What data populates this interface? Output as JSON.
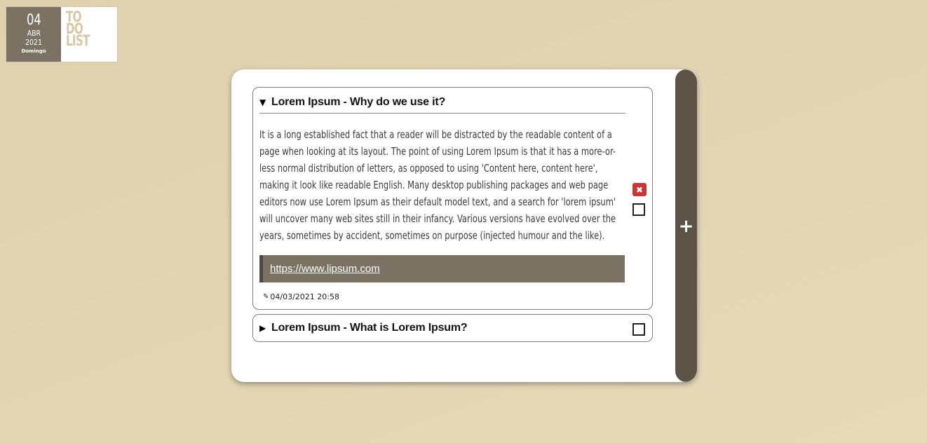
{
  "date_badge": {
    "day": "04",
    "month": "ABR",
    "year": "2021",
    "weekday": "Domingo"
  },
  "logo": {
    "lines": [
      "TO",
      "DO",
      "LIST"
    ]
  },
  "card": {
    "add_label": "+",
    "tasks": [
      {
        "expanded": true,
        "caret": "▼",
        "title": "Lorem Ipsum - Why do we use it?",
        "body": "It is a long established fact that a reader will be distracted by the readable content of a page when looking at its layout. The point of using Lorem Ipsum is that it has a more-or-less normal distribution of letters, as opposed to using 'Content here, content here', making it look like readable English. Many desktop publishing packages and web page editors now use Lorem Ipsum as their default model text, and a search for 'lorem ipsum' will uncover many web sites still in their infancy. Various versions have evolved over the years, sometimes by accident, sometimes on purpose (injected humour and the like).",
        "link": "https://www.lipsum.com",
        "timestamp": "04/03/2021 20:58",
        "delete_label": "✖",
        "checked": false
      },
      {
        "expanded": false,
        "caret": "▶",
        "title": "Lorem Ipsum - What is Lorem Ipsum?",
        "checked": false
      }
    ]
  },
  "colors": {
    "background": "#e0d3af",
    "date_block": "#7b7263",
    "logo_text": "#d8c8a2",
    "sidebar": "#5a5346",
    "link_box": "#7b7263",
    "delete_button": "#c6373a"
  },
  "icons": {
    "pencil": "pencil-icon",
    "add": "plus-icon",
    "delete": "close-icon",
    "expand": "caret-icon"
  }
}
